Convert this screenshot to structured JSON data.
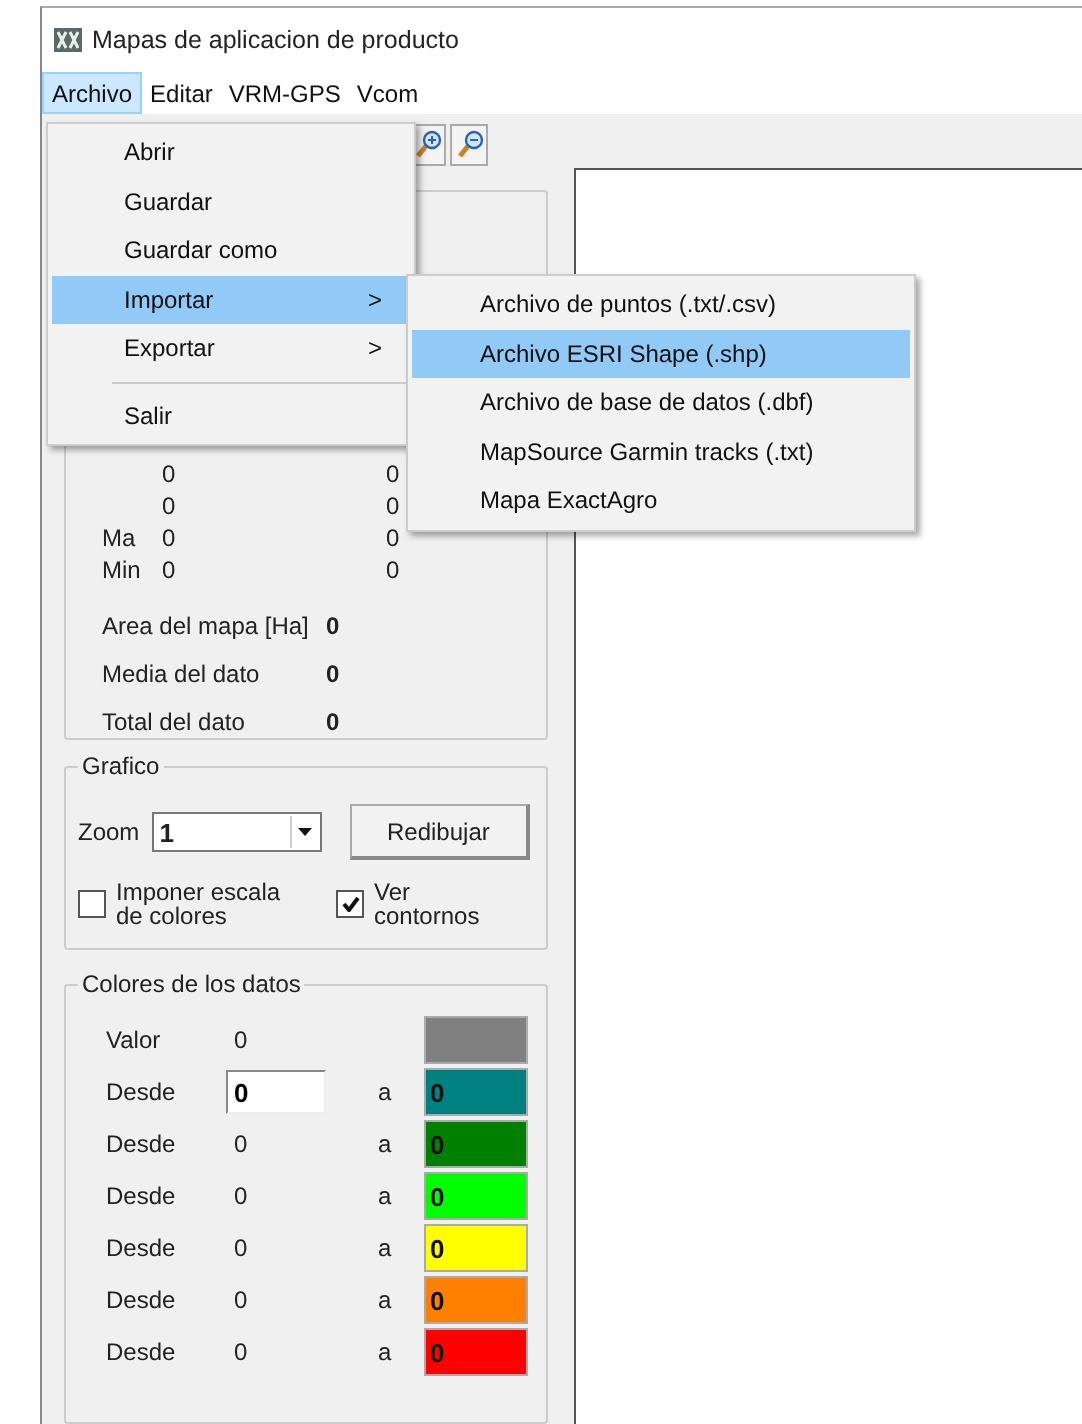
{
  "window": {
    "title": "Mapas de aplicacion de producto"
  },
  "menu_bar": [
    {
      "label": "Archivo",
      "selected": true
    },
    {
      "label": "Editar",
      "selected": false
    },
    {
      "label": "VRM-GPS",
      "selected": false
    },
    {
      "label": "Vcom",
      "selected": false
    }
  ],
  "open_menu": [
    {
      "kind": "item",
      "label": "Abrir",
      "selected": false
    },
    {
      "kind": "item",
      "label": "Guardar",
      "selected": false
    },
    {
      "kind": "item",
      "label": "Guardar como",
      "selected": false
    },
    {
      "kind": "submenu",
      "label": "Importar",
      "arrow": ">",
      "selected": true
    },
    {
      "kind": "submenu",
      "label": "Exportar",
      "arrow": ">",
      "selected": false
    },
    {
      "kind": "separator"
    },
    {
      "kind": "item",
      "label": "Salir",
      "selected": false
    }
  ],
  "submenu": [
    {
      "label": "Archivo de puntos (.txt/.csv)",
      "selected": false
    },
    {
      "label": "Archivo ESRI Shape (.shp)",
      "selected": true
    },
    {
      "label": "Archivo de base de datos (.dbf)",
      "selected": false
    },
    {
      "label": "MapSource Garmin tracks (.txt)",
      "selected": false
    },
    {
      "label": "Mapa ExactAgro",
      "selected": false
    }
  ],
  "stats": {
    "rows": [
      {
        "col1": "0",
        "col2": "0"
      },
      {
        "col1": "0",
        "col2": "0"
      },
      {
        "label": "Ma",
        "col1": "0",
        "col2": "0"
      },
      {
        "label": "Min",
        "col1": "0",
        "col2": "0"
      }
    ],
    "summary": [
      {
        "label": "Area del mapa [Ha]",
        "value": "0"
      },
      {
        "label": "Media del dato",
        "value": "0"
      },
      {
        "label": "Total del dato",
        "value": "0"
      }
    ]
  },
  "grafico": {
    "title": "Grafico",
    "zoom_label": "Zoom",
    "zoom_value": "1",
    "redraw_button": "Redibujar",
    "checkboxes": [
      {
        "label": "Imponer escala de colores",
        "checked": false
      },
      {
        "label": "Ver contornos",
        "checked": true
      }
    ]
  },
  "colores": {
    "title": "Colores de los datos",
    "valor": {
      "label": "Valor",
      "value": "0",
      "color": "#808080"
    },
    "rows": [
      {
        "label": "Desde",
        "kind": "input",
        "from": "0",
        "sep": "a",
        "to": "0",
        "color": "#008080"
      },
      {
        "label": "Desde",
        "kind": "text",
        "from": "0",
        "sep": "a",
        "to": "0",
        "color": "#008000"
      },
      {
        "label": "Desde",
        "kind": "text",
        "from": "0",
        "sep": "a",
        "to": "0",
        "color": "#00ff00"
      },
      {
        "label": "Desde",
        "kind": "text",
        "from": "0",
        "sep": "a",
        "to": "0",
        "color": "#ffff00"
      },
      {
        "label": "Desde",
        "kind": "text",
        "from": "0",
        "sep": "a",
        "to": "0",
        "color": "#ff8000"
      },
      {
        "label": "Desde",
        "kind": "text",
        "from": "0",
        "sep": "a",
        "to": "0",
        "color": "#ff0000"
      }
    ]
  }
}
